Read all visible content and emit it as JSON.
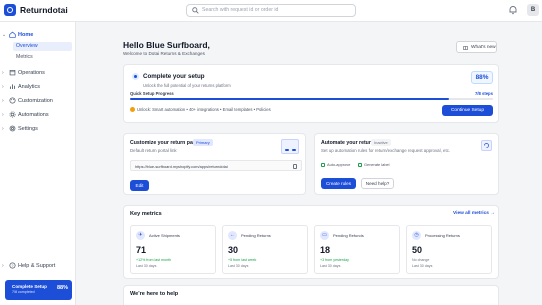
{
  "app": {
    "brand": "Returndotai"
  },
  "search": {
    "placeholder": "Search with request id or order id"
  },
  "user": {
    "initial": "B"
  },
  "sidebar": {
    "home": "Home",
    "overview": "Overview",
    "metrics": "Metrics",
    "operations": "Operations",
    "analytics": "Analytics",
    "customization": "Customization",
    "automations": "Automations",
    "settings": "Settings",
    "help": "Help & Support",
    "setup_card": {
      "title": "Complete Setup",
      "subtitle": "7/8 completed",
      "percent": "88%"
    }
  },
  "header": {
    "title": "Hello Blue Surfboard,",
    "subtitle": "Welcome to Dotai Returns & Exchanges",
    "whats_new": "What's new"
  },
  "setup": {
    "title": "Complete your setup",
    "description": "Unlock the full potential of your returns platform",
    "percent": "88%",
    "progress_label": "Quick Setup Progress",
    "steps": "7/8 steps",
    "progress_fraction": 0.88,
    "unlock_text": "Unlock: Smart automation • 40+ integrations • Email templates • Policies",
    "continue_label": "Continue Setup"
  },
  "return_page": {
    "title": "Customize your return page",
    "badge": "Primary",
    "subtitle": "Default return portal link",
    "url": "https://blue-surfboard.myshopify.com/apps/returndotai",
    "edit_label": "Edit"
  },
  "automate": {
    "title": "Automate your return",
    "badge": "Inactive",
    "subtitle": "Set up automation rules for return/exchange request approval, etc.",
    "check1": "Auto-approve",
    "check2": "Generate label",
    "create_label": "Create rules",
    "help_label": "Need help?"
  },
  "metrics": {
    "title": "Key metrics",
    "view_all": "View all metrics",
    "items": [
      {
        "label": "Active Shipments",
        "value": "71",
        "change": "+12% from last month",
        "change_color": "#16a34a",
        "period": "Last 30 days"
      },
      {
        "label": "Pending Returns",
        "value": "30",
        "change": "+5 from last week",
        "change_color": "#16a34a",
        "period": "Last 30 days"
      },
      {
        "label": "Pending Refunds",
        "value": "18",
        "change": "+3 from yesterday",
        "change_color": "#16a34a",
        "period": "Last 30 days"
      },
      {
        "label": "Processing Returns",
        "value": "50",
        "change": "No change",
        "change_color": "#6b7280",
        "period": "Last 30 days"
      }
    ]
  },
  "help_section": {
    "title": "We're here to help"
  },
  "colors": {
    "accent": "#1d4ed8",
    "positive": "#16a34a"
  }
}
